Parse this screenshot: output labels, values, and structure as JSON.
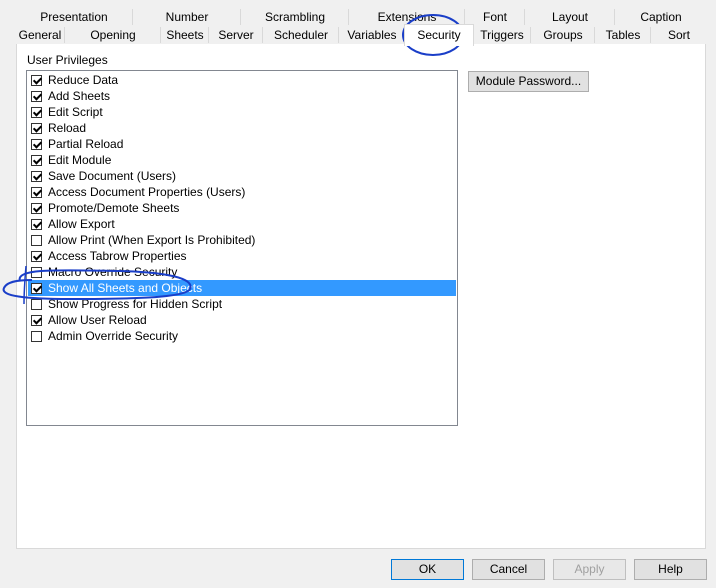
{
  "tabs": {
    "row1": [
      "Presentation",
      "Number",
      "Scrambling",
      "Extensions",
      "Font",
      "Layout",
      "Caption"
    ],
    "row2": [
      "General",
      "Opening",
      "Sheets",
      "Server",
      "Scheduler",
      "Variables",
      "Security",
      "Triggers",
      "Groups",
      "Tables",
      "Sort"
    ],
    "active": "Security"
  },
  "user_privileges": {
    "title": "User Privileges",
    "items": [
      {
        "label": "Reduce Data",
        "checked": true
      },
      {
        "label": "Add Sheets",
        "checked": true
      },
      {
        "label": "Edit Script",
        "checked": true
      },
      {
        "label": "Reload",
        "checked": true
      },
      {
        "label": "Partial Reload",
        "checked": true
      },
      {
        "label": "Edit Module",
        "checked": true
      },
      {
        "label": "Save Document (Users)",
        "checked": true
      },
      {
        "label": "Access Document Properties (Users)",
        "checked": true
      },
      {
        "label": "Promote/Demote Sheets",
        "checked": true
      },
      {
        "label": "Allow Export",
        "checked": true
      },
      {
        "label": "Allow Print (When Export Is Prohibited)",
        "checked": false
      },
      {
        "label": "Access Tabrow Properties",
        "checked": true
      },
      {
        "label": "Macro Override Security",
        "checked": false
      },
      {
        "label": "Show All Sheets and Objects",
        "checked": true,
        "selected": true
      },
      {
        "label": "Show Progress for Hidden Script",
        "checked": false
      },
      {
        "label": "Allow User Reload",
        "checked": true
      },
      {
        "label": "Admin Override Security",
        "checked": false
      }
    ]
  },
  "module_password_label": "Module Password...",
  "footer": {
    "ok": "OK",
    "cancel": "Cancel",
    "apply": "Apply",
    "help": "Help"
  },
  "colors": {
    "selection": "#3399ff",
    "annotation": "#1a3ec8"
  }
}
